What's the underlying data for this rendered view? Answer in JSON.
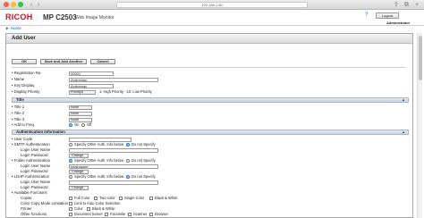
{
  "browser": {
    "url": "192.168.1.80"
  },
  "header": {
    "logo": "RICOH",
    "model": "MP C2503",
    "app": "Web Image Monitor",
    "home": "► Home",
    "logout": "Logout",
    "user": "Administrator"
  },
  "panel": {
    "title": "Add User",
    "ok": "OK",
    "save_add": "Save and Add Another",
    "cancel": "Cancel"
  },
  "registration": {
    "reg_no_label": "• Registration No.",
    "reg_no": "00001",
    "name_label": "• Name",
    "name": "Andremac",
    "key_label": "• Key Display",
    "key": "Andremac",
    "priority_label": "• Display Priority",
    "priority": "Priority5",
    "priority_hint": "1: High Priority - 10: Low Priority"
  },
  "title_section": {
    "header": "Title",
    "title1_label": "• Title 1",
    "title1": "None",
    "title2_label": "• Title 2",
    "title2": "None",
    "title3_label": "• Title 3",
    "title3": "None",
    "freq_label": "• Add to Freq.",
    "on": "On",
    "off": "Off"
  },
  "auth_section": {
    "header": "Authentication Information",
    "user_code_label": "• User Code",
    "smtp_label": "• SMTP Authentication",
    "specify_other": "Specify Other Auth. Info below",
    "do_not_specify": "Do not Specify",
    "login_user_label": "Login User Name",
    "login_pw_label": "Login Password",
    "change": "Change",
    "folder_label": "• Folder Authentication",
    "folder_user": "totalmaster",
    "ldap_label": "• LDAP Authentication",
    "available_label": "• Available Functions",
    "copier_label": "Copier",
    "full_color": "Full Color",
    "two_color": "Two-color",
    "single_color": "Single Color",
    "black_white": "Black & White",
    "ccm_label": "Color Copy Mode Limitation",
    "limit_auto": "Limit to Auto Color Selection",
    "printer_label": "Printer",
    "color": "Color",
    "other_label": "Other functions",
    "doc_server": "Document Server",
    "facsimile": "Facsimile",
    "scanner": "Scanner",
    "browser": "Browser"
  },
  "colors": {
    "logo": "#c8102e",
    "section": "#c9d3df",
    "link": "#2255aa"
  }
}
